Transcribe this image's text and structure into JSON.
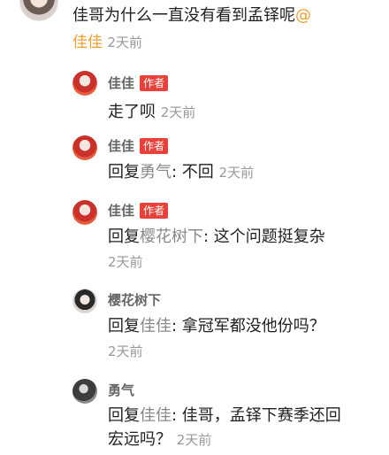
{
  "top_comment": {
    "text": "佳哥为什么一直没有看到孟铎呢",
    "at_symbol": "@",
    "author": "佳佳",
    "time": "2天前"
  },
  "replies": [
    {
      "name": "佳佳",
      "badge": "作者",
      "text": "走了呗",
      "time": "2天前"
    },
    {
      "name": "佳佳",
      "badge": "作者",
      "prefix": "回复",
      "target": "勇气",
      "text": ": 不回",
      "time": "2天前"
    },
    {
      "name": "佳佳",
      "badge": "作者",
      "prefix": "回复",
      "target": "樱花树下",
      "text": ": 这个问题挺复杂",
      "time": "2天前"
    },
    {
      "name": "樱花树下",
      "prefix": "回复",
      "target": "佳佳",
      "text": ": 拿冠军都没他份吗？",
      "time": "2天前"
    },
    {
      "name": "勇气",
      "prefix": "回复",
      "target": "佳佳",
      "text": ": 佳哥，孟铎下赛季还回",
      "text2": "宏远吗？",
      "time": "2天前"
    }
  ],
  "colors": {
    "accent_orange": "#f0a030",
    "author_badge": "#e8413a",
    "muted": "#999999"
  },
  "icons": [
    "user-avatar-icon",
    "author-avatar-icon",
    "user-avatar-icon",
    "user-avatar-icon"
  ]
}
